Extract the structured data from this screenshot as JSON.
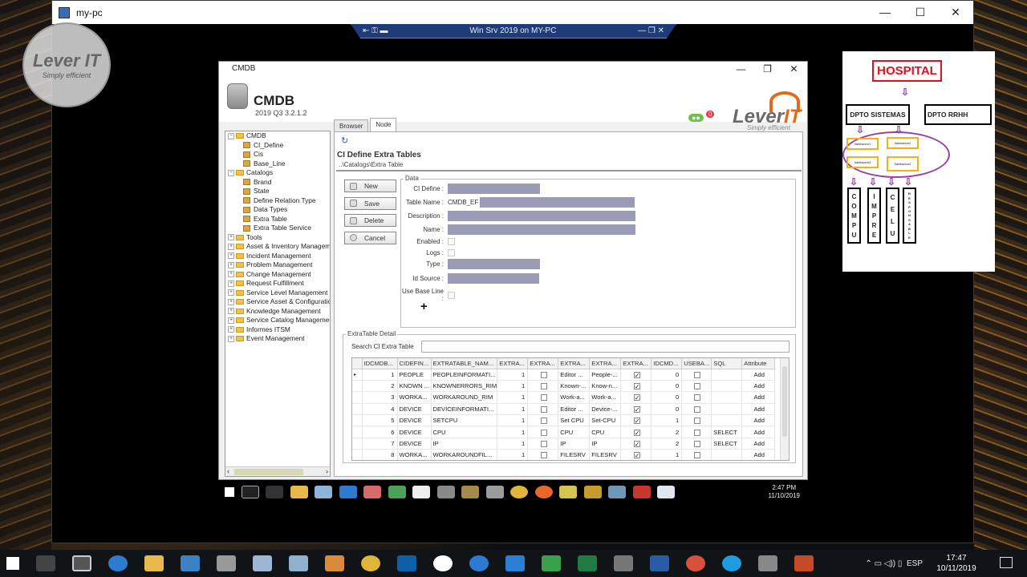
{
  "vm": {
    "window_title": "my-pc",
    "connection_bar": "Win Srv 2019 on MY-PC",
    "controls": [
      "—",
      "☐",
      "✕"
    ]
  },
  "watermark": {
    "name": "Lever IT",
    "tagline": "Simply efficient"
  },
  "app": {
    "window_title": "CMDB",
    "name": "CMDB",
    "version": "2019 Q3 3.2.1.2",
    "controls": [
      "—",
      "❐",
      "✕"
    ],
    "badge_count": "0",
    "logo": {
      "text": "Lever",
      "accent": "IT",
      "tagline": "Simply efficient"
    },
    "tree": [
      {
        "label": "CMDB",
        "level": 0,
        "type": "folder",
        "expanded": true
      },
      {
        "label": "CI_Define",
        "level": 1,
        "type": "leaf"
      },
      {
        "label": "Cis",
        "level": 1,
        "type": "leaf"
      },
      {
        "label": "Base_Line",
        "level": 1,
        "type": "leaf"
      },
      {
        "label": "Catalogs",
        "level": 0,
        "type": "folder",
        "expanded": true
      },
      {
        "label": "Brand",
        "level": 1,
        "type": "leaf"
      },
      {
        "label": "State",
        "level": 1,
        "type": "leaf"
      },
      {
        "label": "Define Relation Type",
        "level": 1,
        "type": "leaf"
      },
      {
        "label": "Data Types",
        "level": 1,
        "type": "leaf"
      },
      {
        "label": "Extra Table",
        "level": 1,
        "type": "leaf"
      },
      {
        "label": "Extra Table Service",
        "level": 1,
        "type": "leaf"
      },
      {
        "label": "Tools",
        "level": 0,
        "type": "folder",
        "expanded": false
      },
      {
        "label": "Asset & Inventory Management",
        "level": 0,
        "type": "folder",
        "expanded": false
      },
      {
        "label": "Incident Management",
        "level": 0,
        "type": "folder",
        "expanded": false
      },
      {
        "label": "Problem Management",
        "level": 0,
        "type": "folder",
        "expanded": false
      },
      {
        "label": "Change Management",
        "level": 0,
        "type": "folder",
        "expanded": false
      },
      {
        "label": "Request Fulfillment",
        "level": 0,
        "type": "folder",
        "expanded": false
      },
      {
        "label": "Service Level Management",
        "level": 0,
        "type": "folder",
        "expanded": false
      },
      {
        "label": "Service Asset & Configuration",
        "level": 0,
        "type": "folder",
        "expanded": false
      },
      {
        "label": "Knowledge Management",
        "level": 0,
        "type": "folder",
        "expanded": false
      },
      {
        "label": "Service Catalog Management",
        "level": 0,
        "type": "folder",
        "expanded": false
      },
      {
        "label": "Informes ITSM",
        "level": 0,
        "type": "folder",
        "expanded": false
      },
      {
        "label": "Event Management",
        "level": 0,
        "type": "folder",
        "expanded": false
      }
    ],
    "tabs": [
      "Browser",
      "Node"
    ],
    "active_tab": "Node",
    "pane": {
      "title": "CI Define Extra Tables",
      "path": "..\\Catalogs\\Extra Table"
    },
    "buttons": {
      "new": "New",
      "save": "Save",
      "delete": "Delete",
      "cancel": "Cancel"
    },
    "data": {
      "legend": "Data",
      "ci_define_label": "CI Define :",
      "table_name_label": "Table Name :",
      "table_name_prefix": "CMDB_EF",
      "description_label": "Description :",
      "name_label": "Name :",
      "enabled_label": "Enabled :",
      "logs_label": "Logs :",
      "type_label": "Type :",
      "id_source_label": "Id Source :",
      "use_base_line_label": "Use Base Line :",
      "add_symbol": "+"
    },
    "detail": {
      "legend": "ExtraTable Detail",
      "search_label": "Search CI Extra Table",
      "search_value": "",
      "columns": [
        "IDCMDB...",
        "CIDEFIN...",
        "EXTRATABLE_NAM...",
        "EXTRA...",
        "EXTRA...",
        "EXTRA...",
        "EXTRA...",
        "EXTRA...",
        "IDCMD...",
        "USEBA...",
        "SQL",
        "Attribute"
      ],
      "rows": [
        {
          "id": "1",
          "cidef": "PEOPLE",
          "name": "PEOPLEINFORMATI...",
          "n1": "1",
          "c1": false,
          "e1": "Editor ...",
          "e2": "People-...",
          "c2": true,
          "idc": "0",
          "c3": false,
          "sql": "",
          "attr": "Add"
        },
        {
          "id": "2",
          "cidef": "KNOWN ...",
          "name": "KNOWNERRORS_RIM",
          "n1": "1",
          "c1": false,
          "e1": "Known-...",
          "e2": "Know-n...",
          "c2": true,
          "idc": "0",
          "c3": false,
          "sql": "",
          "attr": "Add"
        },
        {
          "id": "3",
          "cidef": "WORKA...",
          "name": "WORKAROUND_RIM",
          "n1": "1",
          "c1": false,
          "e1": "Work-a...",
          "e2": "Work-a...",
          "c2": true,
          "idc": "0",
          "c3": false,
          "sql": "",
          "attr": "Add"
        },
        {
          "id": "4",
          "cidef": "DEVICE",
          "name": "DEVICEINFORMATI...",
          "n1": "1",
          "c1": false,
          "e1": "Editor ...",
          "e2": "Device-...",
          "c2": true,
          "idc": "0",
          "c3": false,
          "sql": "",
          "attr": "Add"
        },
        {
          "id": "5",
          "cidef": "DEVICE",
          "name": "SETCPU",
          "n1": "1",
          "c1": false,
          "e1": "Set CPU",
          "e2": "Set-CPU",
          "c2": true,
          "idc": "1",
          "c3": false,
          "sql": "",
          "attr": "Add"
        },
        {
          "id": "6",
          "cidef": "DEVICE",
          "name": "CPU",
          "n1": "1",
          "c1": false,
          "e1": "CPU",
          "e2": "CPU",
          "c2": true,
          "idc": "2",
          "c3": false,
          "sql": "SELECT",
          "attr": "Add"
        },
        {
          "id": "7",
          "cidef": "DEVICE",
          "name": "IP",
          "n1": "1",
          "c1": false,
          "e1": "IP",
          "e2": "IP",
          "c2": true,
          "idc": "2",
          "c3": false,
          "sql": "SELECT",
          "attr": "Add"
        },
        {
          "id": "8",
          "cidef": "WORKA...",
          "name": "WORKAROUNDFIL...",
          "n1": "1",
          "c1": false,
          "e1": "FILESRV",
          "e2": "FILESRV",
          "c2": true,
          "idc": "1",
          "c3": false,
          "sql": "",
          "attr": "Add"
        }
      ]
    }
  },
  "guest_taskbar": {
    "time": "2:47 PM",
    "date": "11/10/2019"
  },
  "diagram": {
    "hospital": "HOSPITAL",
    "dept1": "DPTO SISTEMAS",
    "dept2": "DPTO RRHH",
    "rooms": [
      "habitacion1",
      "habitacion2",
      "habitacion3",
      "habitacion4"
    ],
    "items": [
      [
        "C",
        "O",
        "M",
        "P",
        "U"
      ],
      [
        "I",
        "M",
        "P",
        "R",
        "E"
      ],
      [
        "C",
        "E",
        "L",
        "U"
      ],
      [
        "R",
        "E",
        "S",
        "P",
        "O",
        "N",
        "S",
        "A",
        "B",
        "L",
        "E"
      ]
    ]
  },
  "host_taskbar": {
    "time": "17:47",
    "date": "10/11/2019",
    "language": "ESP"
  },
  "colors": {
    "accent_orange": "#e06b19",
    "field_fill": "#9b9bb8",
    "diagram_purple": "#9a3fa3",
    "diagram_red": "#d12"
  }
}
